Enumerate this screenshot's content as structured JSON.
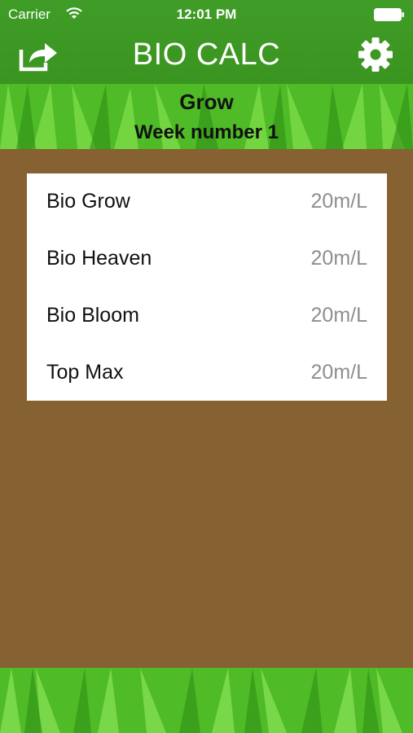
{
  "status_bar": {
    "carrier": "Carrier",
    "time": "12:01 PM"
  },
  "nav": {
    "title": "BIO CALC",
    "share_icon": "share-icon",
    "settings_icon": "gear-icon"
  },
  "header": {
    "stage": "Grow",
    "week": "Week number 1"
  },
  "products": [
    {
      "name": "Bio Grow",
      "dose": "20m/L"
    },
    {
      "name": "Bio Heaven",
      "dose": "20m/L"
    },
    {
      "name": "Bio Bloom",
      "dose": "20m/L"
    },
    {
      "name": "Top Max",
      "dose": "20m/L"
    }
  ],
  "colors": {
    "nav_green": "#3f9d27",
    "soil_brown": "#866233",
    "grass_green": "#4cb526"
  }
}
